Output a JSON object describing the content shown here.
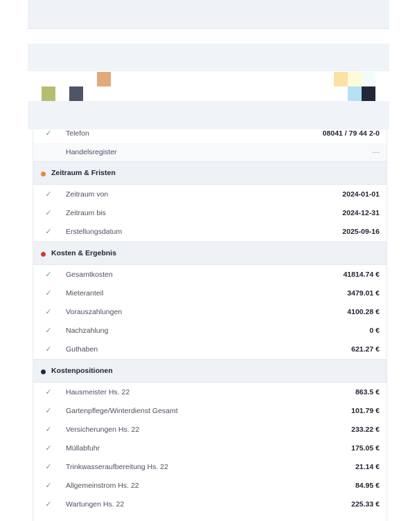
{
  "colors": {
    "orange": "#e8872e",
    "red": "#d23a35",
    "navy": "#1f2a44",
    "check": "#4bb27a",
    "swatch_olive": "#b7bd6f",
    "swatch_slate": "#4d5566",
    "swatch_tan": "#e2aa7a",
    "swatch_peach": "#fce0a5",
    "swatch_cream": "#fffbd8",
    "swatch_mint": "#f3fbfb",
    "swatch_sky": "#b4e1f6",
    "swatch_dark": "#222838"
  },
  "top_rows": [
    {
      "check": "✓",
      "label": "Telefon",
      "value": "08041 / 79 44 2-0"
    },
    {
      "check": "",
      "label": "Handelsregister",
      "value": "—"
    }
  ],
  "sections": [
    {
      "title": "Zeitraum & Fristen",
      "rows": [
        {
          "check": "✓",
          "label": "Zeitraum von",
          "value": "2024-01-01"
        },
        {
          "check": "✓",
          "label": "Zeitraum bis",
          "value": "2024-12-31"
        },
        {
          "check": "✓",
          "label": "Erstellungsdatum",
          "value": "2025-09-16"
        }
      ]
    },
    {
      "title": "Kosten & Ergebnis",
      "rows": [
        {
          "check": "✓",
          "label": "Gesamtkosten",
          "value": "41814.74 €"
        },
        {
          "check": "✓",
          "label": "Mieteranteil",
          "value": "3479.01 €"
        },
        {
          "check": "✓",
          "label": "Vorauszahlungen",
          "value": "4100.28 €"
        },
        {
          "check": "✓",
          "label": "Nachzahlung",
          "value": "0 €"
        },
        {
          "check": "✓",
          "label": "Guthaben",
          "value": "621.27 €"
        }
      ]
    },
    {
      "title": "Kostenpositionen",
      "rows": [
        {
          "check": "✓",
          "label": "Hausmeister Hs. 22",
          "value": "863.5 €"
        },
        {
          "check": "✓",
          "label": "Gartenpflege/Winterdienst Gesamt",
          "value": "101.79 €"
        },
        {
          "check": "✓",
          "label": "Versicherungen Hs. 22",
          "value": "233.22 €"
        },
        {
          "check": "✓",
          "label": "Müllabfuhr",
          "value": "175.05 €"
        },
        {
          "check": "✓",
          "label": "Trinkwasseraufbereitung Hs. 22",
          "value": "21.14 €"
        },
        {
          "check": "✓",
          "label": "Allgemeinstrom Hs. 22",
          "value": "84.95 €"
        },
        {
          "check": "✓",
          "label": "Wartungen Hs. 22",
          "value": "225.33 €"
        }
      ]
    }
  ]
}
